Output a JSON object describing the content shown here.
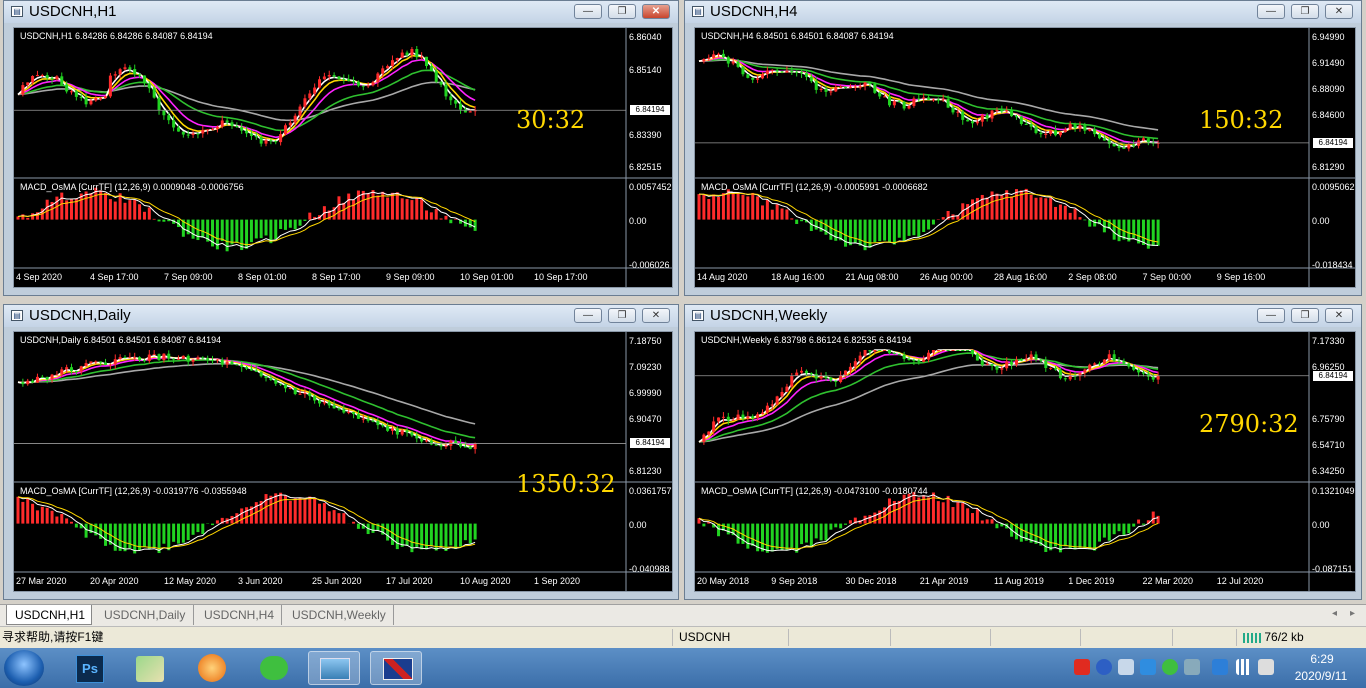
{
  "windows": [
    {
      "id": "h1",
      "title": "USDCNH,H1",
      "info": "USDCNH,H1  6.84286 6.84286 6.84087 6.84194",
      "timer": "30:32",
      "price_levels": [
        "6.86040",
        "6.85140",
        "6.84194",
        "6.83390",
        "6.82515"
      ],
      "macd_info": "MACD_OsMA [CurrTF] (12,26,9) 0.0009048 -0.0006756",
      "macd_levels": [
        "0.0057452",
        "0.00",
        "-0.006026"
      ],
      "dates": [
        "4 Sep 2020",
        "4 Sep 17:00",
        "7 Sep 09:00",
        "8 Sep 01:00",
        "8 Sep 17:00",
        "9 Sep 09:00",
        "10 Sep 01:00",
        "10 Sep 17:00"
      ]
    },
    {
      "id": "h4",
      "title": "USDCNH,H4",
      "info": "USDCNH,H4  6.84501 6.84501 6.84087 6.84194",
      "timer": "150:32",
      "price_levels": [
        "6.94990",
        "6.91490",
        "6.88090",
        "6.84600",
        "6.84194",
        "6.81290"
      ],
      "macd_info": "MACD_OsMA [CurrTF] (12,26,9) -0.0005991 -0.0006682",
      "macd_levels": [
        "0.0095062",
        "0.00",
        "-0.018434"
      ],
      "dates": [
        "14 Aug 2020",
        "18 Aug 16:00",
        "21 Aug 08:00",
        "26 Aug 00:00",
        "28 Aug 16:00",
        "2 Sep 08:00",
        "7 Sep 00:00",
        "9 Sep 16:00"
      ]
    },
    {
      "id": "d1",
      "title": "USDCNH,Daily",
      "info": "USDCNH,Daily  6.84501 6.84501 6.84087 6.84194",
      "timer": "1350:32",
      "price_levels": [
        "7.18750",
        "7.09230",
        "6.99990",
        "6.90470",
        "6.84194",
        "6.81230"
      ],
      "macd_info": "MACD_OsMA [CurrTF] (12,26,9) -0.0319776 -0.0355948",
      "macd_levels": [
        "0.0361757",
        "0.00",
        "-0.040988"
      ],
      "dates": [
        "27 Mar 2020",
        "20 Apr 2020",
        "12 May 2020",
        "3 Jun 2020",
        "25 Jun 2020",
        "17 Jul 2020",
        "10 Aug 2020",
        "1 Sep 2020"
      ]
    },
    {
      "id": "w1",
      "title": "USDCNH,Weekly",
      "info": "USDCNH,Weekly  6.83798 6.86124 6.82535 6.84194",
      "timer": "2790:32",
      "price_levels": [
        "7.17330",
        "6.96250",
        "6.84194",
        "6.75790",
        "6.54710",
        "6.34250"
      ],
      "macd_info": "MACD_OsMA [CurrTF] (12,26,9) -0.0473100 -0.0180744",
      "macd_levels": [
        "0.1321049",
        "0.00",
        "-0.087151"
      ],
      "dates": [
        "20 May 2018",
        "9 Sep 2018",
        "30 Dec 2018",
        "21 Apr 2019",
        "11 Aug 2019",
        "1 Dec 2019",
        "22 Mar 2020",
        "12 Jul 2020"
      ]
    }
  ],
  "tabs": [
    "USDCNH,H1",
    "USDCNH,Daily",
    "USDCNH,H4",
    "USDCNH,Weekly"
  ],
  "status": {
    "help": "寻求帮助,请按F1键",
    "symbol": "USDCNH",
    "traffic": "76/2 kb"
  },
  "clock": {
    "time": "6:29",
    "date": "2020/9/11"
  },
  "icons": {
    "minimize": "—",
    "maximize": "❐",
    "close": "✕"
  },
  "colors": {
    "bull": "#ff2b2b",
    "bear": "#21d321",
    "ma_fast": "#ffffff",
    "ma_yellow": "#ffd700",
    "ma_magenta": "#ff22ff",
    "ma_green": "#2fc02f",
    "ma_gray": "#a8a8a8",
    "timer": "#ffd700"
  }
}
